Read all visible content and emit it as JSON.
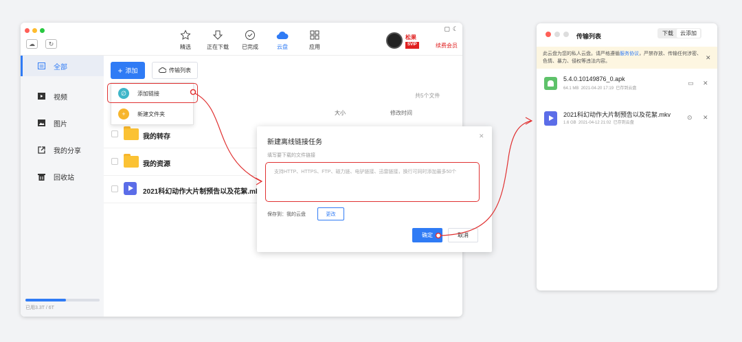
{
  "colors": {
    "accent": "#2f7bf5",
    "annotation": "#e03030",
    "folder": "#fbc234",
    "video": "#5b6de8",
    "apk": "#5ec26a",
    "vip": "#e02020"
  },
  "main_window": {
    "topnav": [
      {
        "label": "精选",
        "icon": "star-icon"
      },
      {
        "label": "正在下载",
        "icon": "download-icon"
      },
      {
        "label": "已完成",
        "icon": "check-circle-icon"
      },
      {
        "label": "云盘",
        "icon": "cloud-icon",
        "active": true
      },
      {
        "label": "应用",
        "icon": "apps-grid-icon"
      }
    ],
    "user": {
      "name": "松果",
      "vip_badge": "SVIP",
      "renew_label": "续费会员"
    },
    "sidebar": {
      "items": [
        {
          "label": "全部",
          "icon": "all-files-icon",
          "active": true
        },
        {
          "label": "视频",
          "icon": "video-icon"
        },
        {
          "label": "图片",
          "icon": "image-icon"
        },
        {
          "label": "我的分享",
          "icon": "share-icon"
        },
        {
          "label": "回收站",
          "icon": "trash-icon"
        }
      ],
      "storage_text": "已用3.3T / 6T",
      "storage_used_fraction": 0.55
    },
    "toolbar": {
      "add_label": "添加",
      "transfer_label": "传输列表"
    },
    "dropdown": [
      {
        "label": "添加链接",
        "icon": "link-icon"
      },
      {
        "label": "新建文件夹",
        "icon": "new-folder-icon"
      }
    ],
    "file_list": {
      "total_count": "共5个文件",
      "col_size": "大小",
      "col_mtime": "修改时间",
      "rows": [
        {
          "name": "我的转存",
          "type": "folder"
        },
        {
          "name": "我的资源",
          "type": "folder"
        },
        {
          "name": "2021科幻动作大片制预告以及花絮.mkv",
          "type": "video"
        }
      ]
    }
  },
  "dialog": {
    "title": "新建离线链接任务",
    "subtitle": "填写要下载的文件链接",
    "placeholder": "支持HTTP、HTTPS、FTP、磁力链、电驴链接、迅雷链接，换行可同时添加最多50个",
    "save_to": "保存到：我的云盘",
    "change_label": "更改",
    "ok_label": "确定",
    "cancel_label": "取消"
  },
  "transfer_window": {
    "title": "传输列表",
    "tabs": [
      {
        "label": "下载"
      },
      {
        "label": "云添加",
        "active": true
      }
    ],
    "notice_prefix": "此云盘为您的私人云盘。请严格遵循",
    "notice_link": "服务协议",
    "notice_suffix": "，严禁存放、传输任何涉密、色情、暴力、侵权等违法内容。",
    "items": [
      {
        "name": "5.4.0.10149876_0.apk",
        "size": "64.1 MB",
        "date": "2021-04-20 17:19",
        "status": "已存到云盘",
        "icon": "apk-icon"
      },
      {
        "name": "2021科幻动作大片制预告以及花絮.mkv",
        "size": "1.6 GB",
        "date": "2021-04-12 21:02",
        "status": "已存到云盘",
        "icon": "video-file-icon"
      }
    ]
  }
}
